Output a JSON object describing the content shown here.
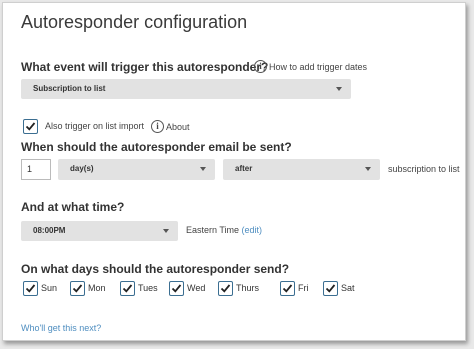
{
  "page": {
    "title": "Autoresponder configuration",
    "trigger": {
      "question": "What event will trigger this autoresponder?",
      "help_link": "How to add trigger dates",
      "select_value": "Subscription to list"
    },
    "import": {
      "checked": true,
      "label": "Also trigger on list import",
      "about": "About"
    },
    "timing": {
      "question": "When should the autoresponder email be sent?",
      "number": "1",
      "unit": "day(s)",
      "direction": "after",
      "suffix": "subscription to list"
    },
    "time": {
      "question": "And at what time?",
      "select_value": "08:00PM",
      "timezone": "Eastern Time",
      "edit_link": "(edit)"
    },
    "days": {
      "question": "On what days should the autoresponder send?",
      "items": [
        {
          "label": "Sun",
          "checked": true
        },
        {
          "label": "Mon",
          "checked": true
        },
        {
          "label": "Tues",
          "checked": true
        },
        {
          "label": "Wed",
          "checked": true
        },
        {
          "label": "Thurs",
          "checked": true
        },
        {
          "label": "Fri",
          "checked": true
        },
        {
          "label": "Sat",
          "checked": true
        }
      ]
    },
    "footer_link": "Who'll get this next?"
  },
  "icons": {
    "info": "info-circle-icon",
    "checkbox": "checkmark-icon",
    "dropdown": "chevron-down-icon"
  },
  "colors": {
    "link": "#4f8ec0",
    "checkbox_border": "#3b6e91",
    "select_bg": "#e2e2e2"
  }
}
